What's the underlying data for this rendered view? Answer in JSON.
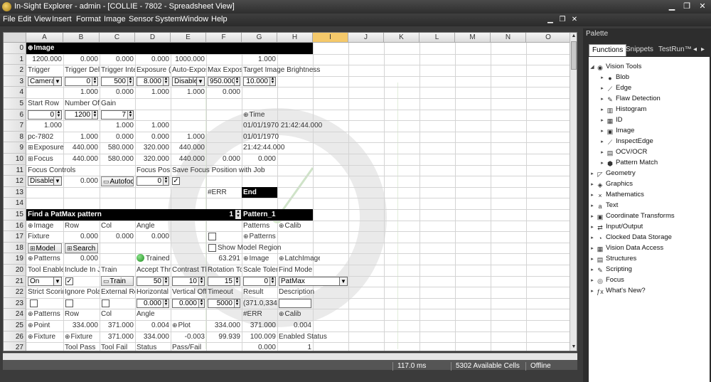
{
  "window": {
    "title": "In-Sight Explorer - admin - [COLLIE - 7802 - Spreadsheet View]"
  },
  "menu": [
    "File",
    "Edit",
    "View",
    "Insert",
    "Format",
    "Image",
    "Sensor",
    "System",
    "Window",
    "Help"
  ],
  "sheet": {
    "columns": [
      "A",
      "B",
      "C",
      "D",
      "E",
      "F",
      "G",
      "H",
      "I",
      "J",
      "K",
      "L",
      "M",
      "N",
      "O"
    ],
    "selected_column": "I",
    "rows": [
      "0",
      "1",
      "2",
      "3",
      "4",
      "5",
      "6",
      "7",
      "8",
      "9",
      "10",
      "11",
      "12",
      "13",
      "14",
      "15",
      "16",
      "17",
      "18",
      "19",
      "20",
      "21",
      "22",
      "23",
      "24",
      "25",
      "26",
      "27"
    ],
    "cells": {
      "r0_image": "Image",
      "r1_a": "1200.000",
      "r1_b": "0.000",
      "r1_c": "0.000",
      "r1_d": "0.000",
      "r1_e": "1000.000",
      "r1_g": "1.000",
      "r2_a": "Trigger",
      "r2_b": "Trigger Del",
      "r2_c": "Trigger Inte",
      "r2_d": "Exposure (",
      "r2_e": "Auto-Expos",
      "r2_f": "Max Expos",
      "r2_g": "Target Image Brightness",
      "r3_a": "Camera",
      "r3_b": "0",
      "r3_c": "500",
      "r3_d": "8.000",
      "r3_e": "Disable",
      "r3_f": "950.000",
      "r3_g": "10.000",
      "r4_b": "1.000",
      "r4_c": "0.000",
      "r4_d": "1.000",
      "r4_e": "1.000",
      "r4_f": "0.000",
      "r5_a": "Start Row",
      "r5_b": "Number Of",
      "r5_c": "Gain",
      "r6_a": "0",
      "r6_b": "1200",
      "r6_c": "7",
      "r6_g": "Time",
      "r7_a": "1.000",
      "r7_c": "1.000",
      "r7_d": "1.000",
      "r7_g": "01/01/1970 21:42:44.000",
      "r8_a": "pc-7802",
      "r8_b": "1.000",
      "r8_c": "0.000",
      "r8_d": "0.000",
      "r8_e": "1.000",
      "r8_g": "01/01/1970",
      "r9_a": "Exposure",
      "r9_b": "440.000",
      "r9_c": "580.000",
      "r9_d": "320.000",
      "r9_e": "440.000",
      "r9_g": "21:42:44.000",
      "r10_a": "Focus",
      "r10_b": "440.000",
      "r10_c": "580.000",
      "r10_d": "320.000",
      "r10_e": "440.000",
      "r10_f": "0.000",
      "r10_g": "0.000",
      "r11_a": "Focus Controls",
      "r11_d": "Focus Pos",
      "r11_e": "Save Focus Position with Job",
      "r12_a": "Disable",
      "r12_b": "0.000",
      "r12_c": "Autofocu",
      "r12_d": "0",
      "r13_f": "#ERR",
      "r13_g": "End",
      "r15_a": "Find a PatMax pattern",
      "r15_f": "1",
      "r15_g": "Pattern_1",
      "r16_a": "Image",
      "r16_b": "Row",
      "r16_c": "Col",
      "r16_d": "Angle",
      "r16_g": "Patterns",
      "r16_h": "Calib",
      "r17_a": "Fixture",
      "r17_b": "0.000",
      "r17_c": "0.000",
      "r17_d": "0.000",
      "r17_g": "Patterns",
      "r18_a": "Model",
      "r18_b": "Search",
      "r18_f": "Show Model Region",
      "r19_a": "Patterns",
      "r19_b": "0.000",
      "r19_d": "Trained",
      "r19_f": "63.291",
      "r19_g": "Image",
      "r19_h": "LatchImage",
      "r20_a": "Tool Enable",
      "r20_b": "Include In J",
      "r20_c": "Train",
      "r20_d": "Accept Thre",
      "r20_e": "Contrast Th",
      "r20_f": "Rotation To",
      "r20_g": "Scale Toler",
      "r20_h": "Find Mode",
      "r21_a": "On",
      "r21_c": "Train",
      "r21_d": "50",
      "r21_e": "10",
      "r21_f": "15",
      "r21_g": "0",
      "r21_h": "PatMax",
      "r22_a": "Strict Scorin",
      "r22_b": "Ignore Pola",
      "r22_c": "External Re",
      "r22_d": "Horizontal (",
      "r22_e": "Vertical Offs",
      "r22_f": "Timeout",
      "r22_g": "Result",
      "r22_h": "Description",
      "r23_d": "0.000",
      "r23_e": "0.000",
      "r23_f": "5000",
      "r23_g": "(371.0,334",
      "r24_a": "Patterns",
      "r24_b": "Row",
      "r24_c": "Col",
      "r24_d": "Angle",
      "r24_f": "#ERR",
      "r24_g": "Calib",
      "r25_a": "Point",
      "r25_b": "334.000",
      "r25_c": "371.000",
      "r25_d": "0.004",
      "r25_e": "Plot",
      "r25_f": "334.000",
      "r25_g": "371.000",
      "r25_h": "0.004",
      "r26_a": "Fixture",
      "r26_b": "Fixture",
      "r26_c": "371.000",
      "r26_d": "334.000",
      "r26_e": "-0.003",
      "r26_f": "99.939",
      "r26_g": "100.009",
      "r26_h": "Enabled Status",
      "r27_b": "Tool Pass",
      "r27_c": "Tool Fail",
      "r27_d": "Status",
      "r27_e": "Pass/Fail",
      "r27_g": "0.000",
      "r27_h": "1"
    }
  },
  "status": {
    "time": "117.0 ms",
    "cells": "5302 Available Cells",
    "mode": "Offline"
  },
  "palette": {
    "title": "Palette",
    "tabs": [
      "Functions",
      "Snippets",
      "TestRun™"
    ],
    "tree": [
      {
        "label": "Vision Tools",
        "level": 0,
        "expanded": true,
        "icon": "vision-tools-icon"
      },
      {
        "label": "Blob",
        "level": 1,
        "icon": "blob-icon"
      },
      {
        "label": "Edge",
        "level": 1,
        "icon": "edge-icon"
      },
      {
        "label": "Flaw Detection",
        "level": 1,
        "icon": "flaw-detection-icon"
      },
      {
        "label": "Histogram",
        "level": 1,
        "icon": "histogram-icon"
      },
      {
        "label": "ID",
        "level": 1,
        "icon": "id-icon"
      },
      {
        "label": "Image",
        "level": 1,
        "icon": "image-icon"
      },
      {
        "label": "InspectEdge",
        "level": 1,
        "icon": "inspectedge-icon"
      },
      {
        "label": "OCV/OCR",
        "level": 1,
        "icon": "ocv-ocr-icon"
      },
      {
        "label": "Pattern Match",
        "level": 1,
        "icon": "pattern-match-icon"
      },
      {
        "label": "Geometry",
        "level": 0,
        "icon": "geometry-icon"
      },
      {
        "label": "Graphics",
        "level": 0,
        "icon": "graphics-icon"
      },
      {
        "label": "Mathematics",
        "level": 0,
        "icon": "mathematics-icon"
      },
      {
        "label": "Text",
        "level": 0,
        "icon": "text-icon"
      },
      {
        "label": "Coordinate Transforms",
        "level": 0,
        "icon": "coordinate-transforms-icon"
      },
      {
        "label": "Input/Output",
        "level": 0,
        "icon": "input-output-icon"
      },
      {
        "label": "Clocked Data Storage",
        "level": 0,
        "icon": "clocked-data-storage-icon"
      },
      {
        "label": "Vision Data Access",
        "level": 0,
        "icon": "vision-data-access-icon"
      },
      {
        "label": "Structures",
        "level": 0,
        "icon": "structures-icon"
      },
      {
        "label": "Scripting",
        "level": 0,
        "icon": "scripting-icon"
      },
      {
        "label": "Focus",
        "level": 0,
        "icon": "focus-icon"
      },
      {
        "label": "What's New?",
        "level": 0,
        "icon": "whats-new-icon"
      }
    ]
  }
}
